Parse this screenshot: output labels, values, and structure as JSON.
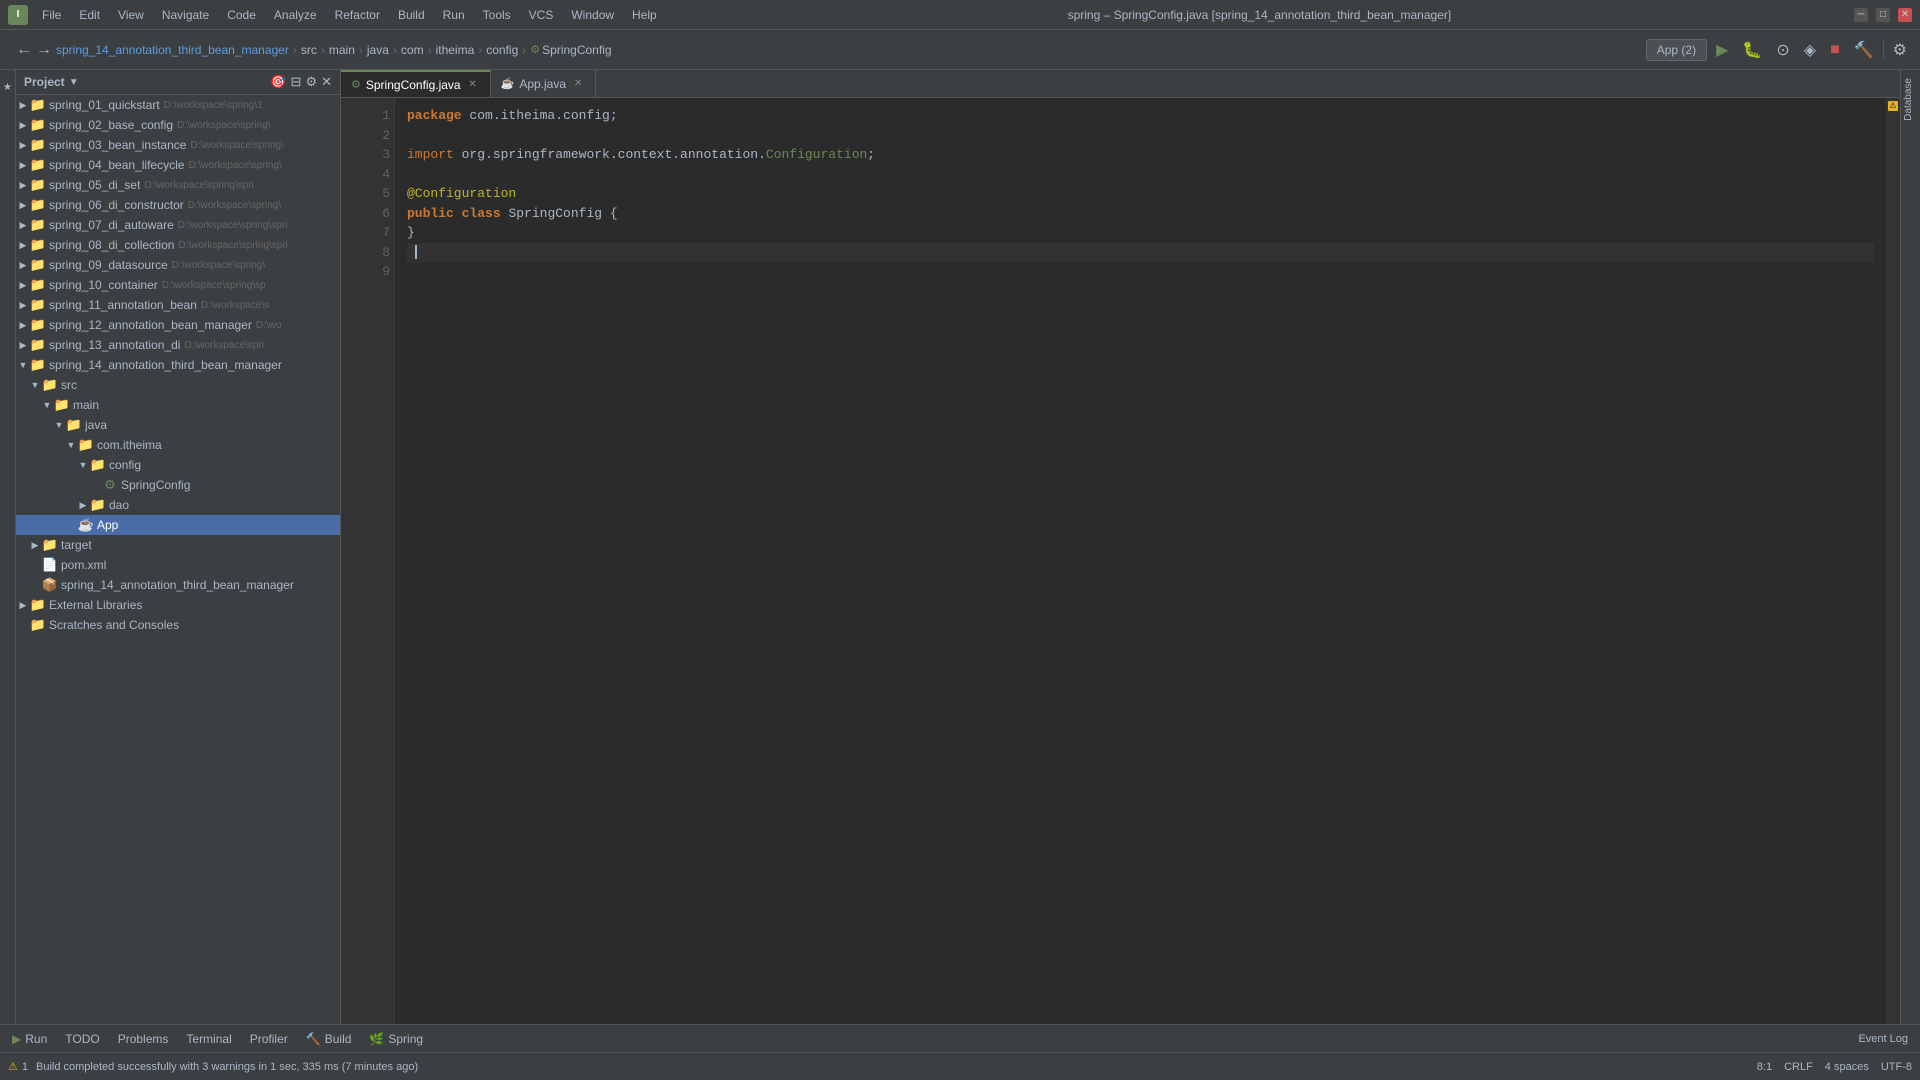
{
  "titleBar": {
    "title": "spring – SpringConfig.java [spring_14_annotation_third_bean_manager]",
    "menus": [
      "File",
      "Edit",
      "View",
      "Navigate",
      "Code",
      "Analyze",
      "Refactor",
      "Build",
      "Run",
      "Tools",
      "VCS",
      "Window",
      "Help"
    ]
  },
  "breadcrumb": {
    "items": [
      "spring_14_annotation_third_bean_manager",
      "src",
      "main",
      "java",
      "com",
      "itheima",
      "config",
      "SpringConfig"
    ]
  },
  "runConfig": {
    "label": "App (2)"
  },
  "tabs": [
    {
      "label": "SpringConfig.java",
      "active": true,
      "closable": true
    },
    {
      "label": "App.java",
      "active": false,
      "closable": true
    }
  ],
  "projectTree": {
    "header": "Project",
    "items": [
      {
        "indent": 0,
        "arrow": "▶",
        "icon": "📁",
        "label": "spring_01_quickstart",
        "path": "D:\\workspace\\spring\\1",
        "level": 0
      },
      {
        "indent": 0,
        "arrow": "▶",
        "icon": "📁",
        "label": "spring_02_base_config",
        "path": "D:\\workspace\\spring\\",
        "level": 0
      },
      {
        "indent": 0,
        "arrow": "▶",
        "icon": "📁",
        "label": "spring_03_bean_instance",
        "path": "D:\\workspace\\spring\\",
        "level": 0
      },
      {
        "indent": 0,
        "arrow": "▶",
        "icon": "📁",
        "label": "spring_04_bean_lifecycle",
        "path": "D:\\workspace\\spring\\",
        "level": 0
      },
      {
        "indent": 0,
        "arrow": "▶",
        "icon": "📁",
        "label": "spring_05_di_set",
        "path": "D:\\workspace\\spring\\spri",
        "level": 0
      },
      {
        "indent": 0,
        "arrow": "▶",
        "icon": "📁",
        "label": "spring_06_di_constructor",
        "path": "D:\\workspace\\spring\\",
        "level": 0
      },
      {
        "indent": 0,
        "arrow": "▶",
        "icon": "📁",
        "label": "spring_07_di_autoware",
        "path": "D:\\workspace\\spring\\spri",
        "level": 0
      },
      {
        "indent": 0,
        "arrow": "▶",
        "icon": "📁",
        "label": "spring_08_di_collection",
        "path": "D:\\workspace\\spring\\spri",
        "level": 0
      },
      {
        "indent": 0,
        "arrow": "▶",
        "icon": "📁",
        "label": "spring_09_datasource",
        "path": "D:\\workspace\\spring\\",
        "level": 0
      },
      {
        "indent": 0,
        "arrow": "▶",
        "icon": "📁",
        "label": "spring_10_container",
        "path": "D:\\workspace\\spring\\sp",
        "level": 0
      },
      {
        "indent": 0,
        "arrow": "▶",
        "icon": "📁",
        "label": "spring_11_annotation_bean",
        "path": "D:\\workspace\\s",
        "level": 0
      },
      {
        "indent": 0,
        "arrow": "▶",
        "icon": "📁",
        "label": "spring_12_annotation_bean_manager",
        "path": "D:\\wo",
        "level": 0
      },
      {
        "indent": 0,
        "arrow": "▶",
        "icon": "📁",
        "label": "spring_13_annotation_di",
        "path": "D:\\workspace\\spri",
        "level": 0
      },
      {
        "indent": 0,
        "arrow": "▼",
        "icon": "📁",
        "label": "spring_14_annotation_third_bean_manager",
        "path": "",
        "level": 0,
        "expanded": true
      },
      {
        "indent": 1,
        "arrow": "▼",
        "icon": "📁",
        "label": "src",
        "path": "",
        "level": 1,
        "expanded": true
      },
      {
        "indent": 2,
        "arrow": "▼",
        "icon": "📁",
        "label": "main",
        "path": "",
        "level": 2,
        "expanded": true
      },
      {
        "indent": 3,
        "arrow": "▼",
        "icon": "📁",
        "label": "java",
        "path": "",
        "level": 3,
        "expanded": true
      },
      {
        "indent": 4,
        "arrow": "▼",
        "icon": "📁",
        "label": "com.itheima",
        "path": "",
        "level": 4,
        "expanded": true
      },
      {
        "indent": 5,
        "arrow": "▼",
        "icon": "📁",
        "label": "config",
        "path": "",
        "level": 5,
        "expanded": true
      },
      {
        "indent": 6,
        "arrow": " ",
        "icon": "☕",
        "label": "SpringConfig",
        "path": "",
        "level": 6,
        "isJava": true
      },
      {
        "indent": 5,
        "arrow": "▶",
        "icon": "📁",
        "label": "dao",
        "path": "",
        "level": 5
      },
      {
        "indent": 4,
        "arrow": " ",
        "icon": "☕",
        "label": "App",
        "path": "",
        "level": 4,
        "isJava": true,
        "selected": true
      },
      {
        "indent": 1,
        "arrow": "▶",
        "icon": "📁",
        "label": "target",
        "path": "",
        "level": 1
      },
      {
        "indent": 1,
        "arrow": " ",
        "icon": "📄",
        "label": "pom.xml",
        "path": "",
        "level": 1,
        "isXml": true
      },
      {
        "indent": 1,
        "arrow": " ",
        "icon": "📄",
        "label": "spring_14_annotation_third_bean_manager",
        "path": "",
        "level": 1,
        "isModule": true
      },
      {
        "indent": 0,
        "arrow": "▶",
        "icon": "📁",
        "label": "External Libraries",
        "path": "",
        "level": 0
      },
      {
        "indent": 0,
        "arrow": " ",
        "icon": "📁",
        "label": "Scratches and Consoles",
        "path": "",
        "level": 0,
        "isSpecial": true
      }
    ]
  },
  "editor": {
    "lineNumbers": [
      "1",
      "2",
      "3",
      "4",
      "5",
      "6",
      "7",
      "8",
      "9"
    ],
    "code": [
      {
        "line": 1,
        "content": "package com.itheima.config;"
      },
      {
        "line": 2,
        "content": ""
      },
      {
        "line": 3,
        "content": "import org.springframework.context.annotation.Configuration;"
      },
      {
        "line": 4,
        "content": ""
      },
      {
        "line": 5,
        "content": "@Configuration"
      },
      {
        "line": 6,
        "content": "public class SpringConfig {"
      },
      {
        "line": 7,
        "content": "}"
      },
      {
        "line": 8,
        "content": ""
      },
      {
        "line": 9,
        "content": ""
      }
    ]
  },
  "statusBar": {
    "warningCount": "1",
    "message": "Build completed successfully with 3 warnings in 1 sec, 335 ms (7 minutes ago)",
    "cursor": "8:1",
    "encoding": "CRLF",
    "lineCol": "4 spaces"
  },
  "bottomTabs": [
    {
      "label": "Run",
      "icon": "▶"
    },
    {
      "label": "TODO",
      "icon": ""
    },
    {
      "label": "Problems",
      "icon": ""
    },
    {
      "label": "Terminal",
      "icon": ""
    },
    {
      "label": "Profiler",
      "icon": ""
    },
    {
      "label": "Build",
      "icon": ""
    },
    {
      "label": "Spring",
      "icon": ""
    }
  ],
  "rightSidebar": {
    "tabs": [
      "Database",
      "Event Log"
    ]
  }
}
